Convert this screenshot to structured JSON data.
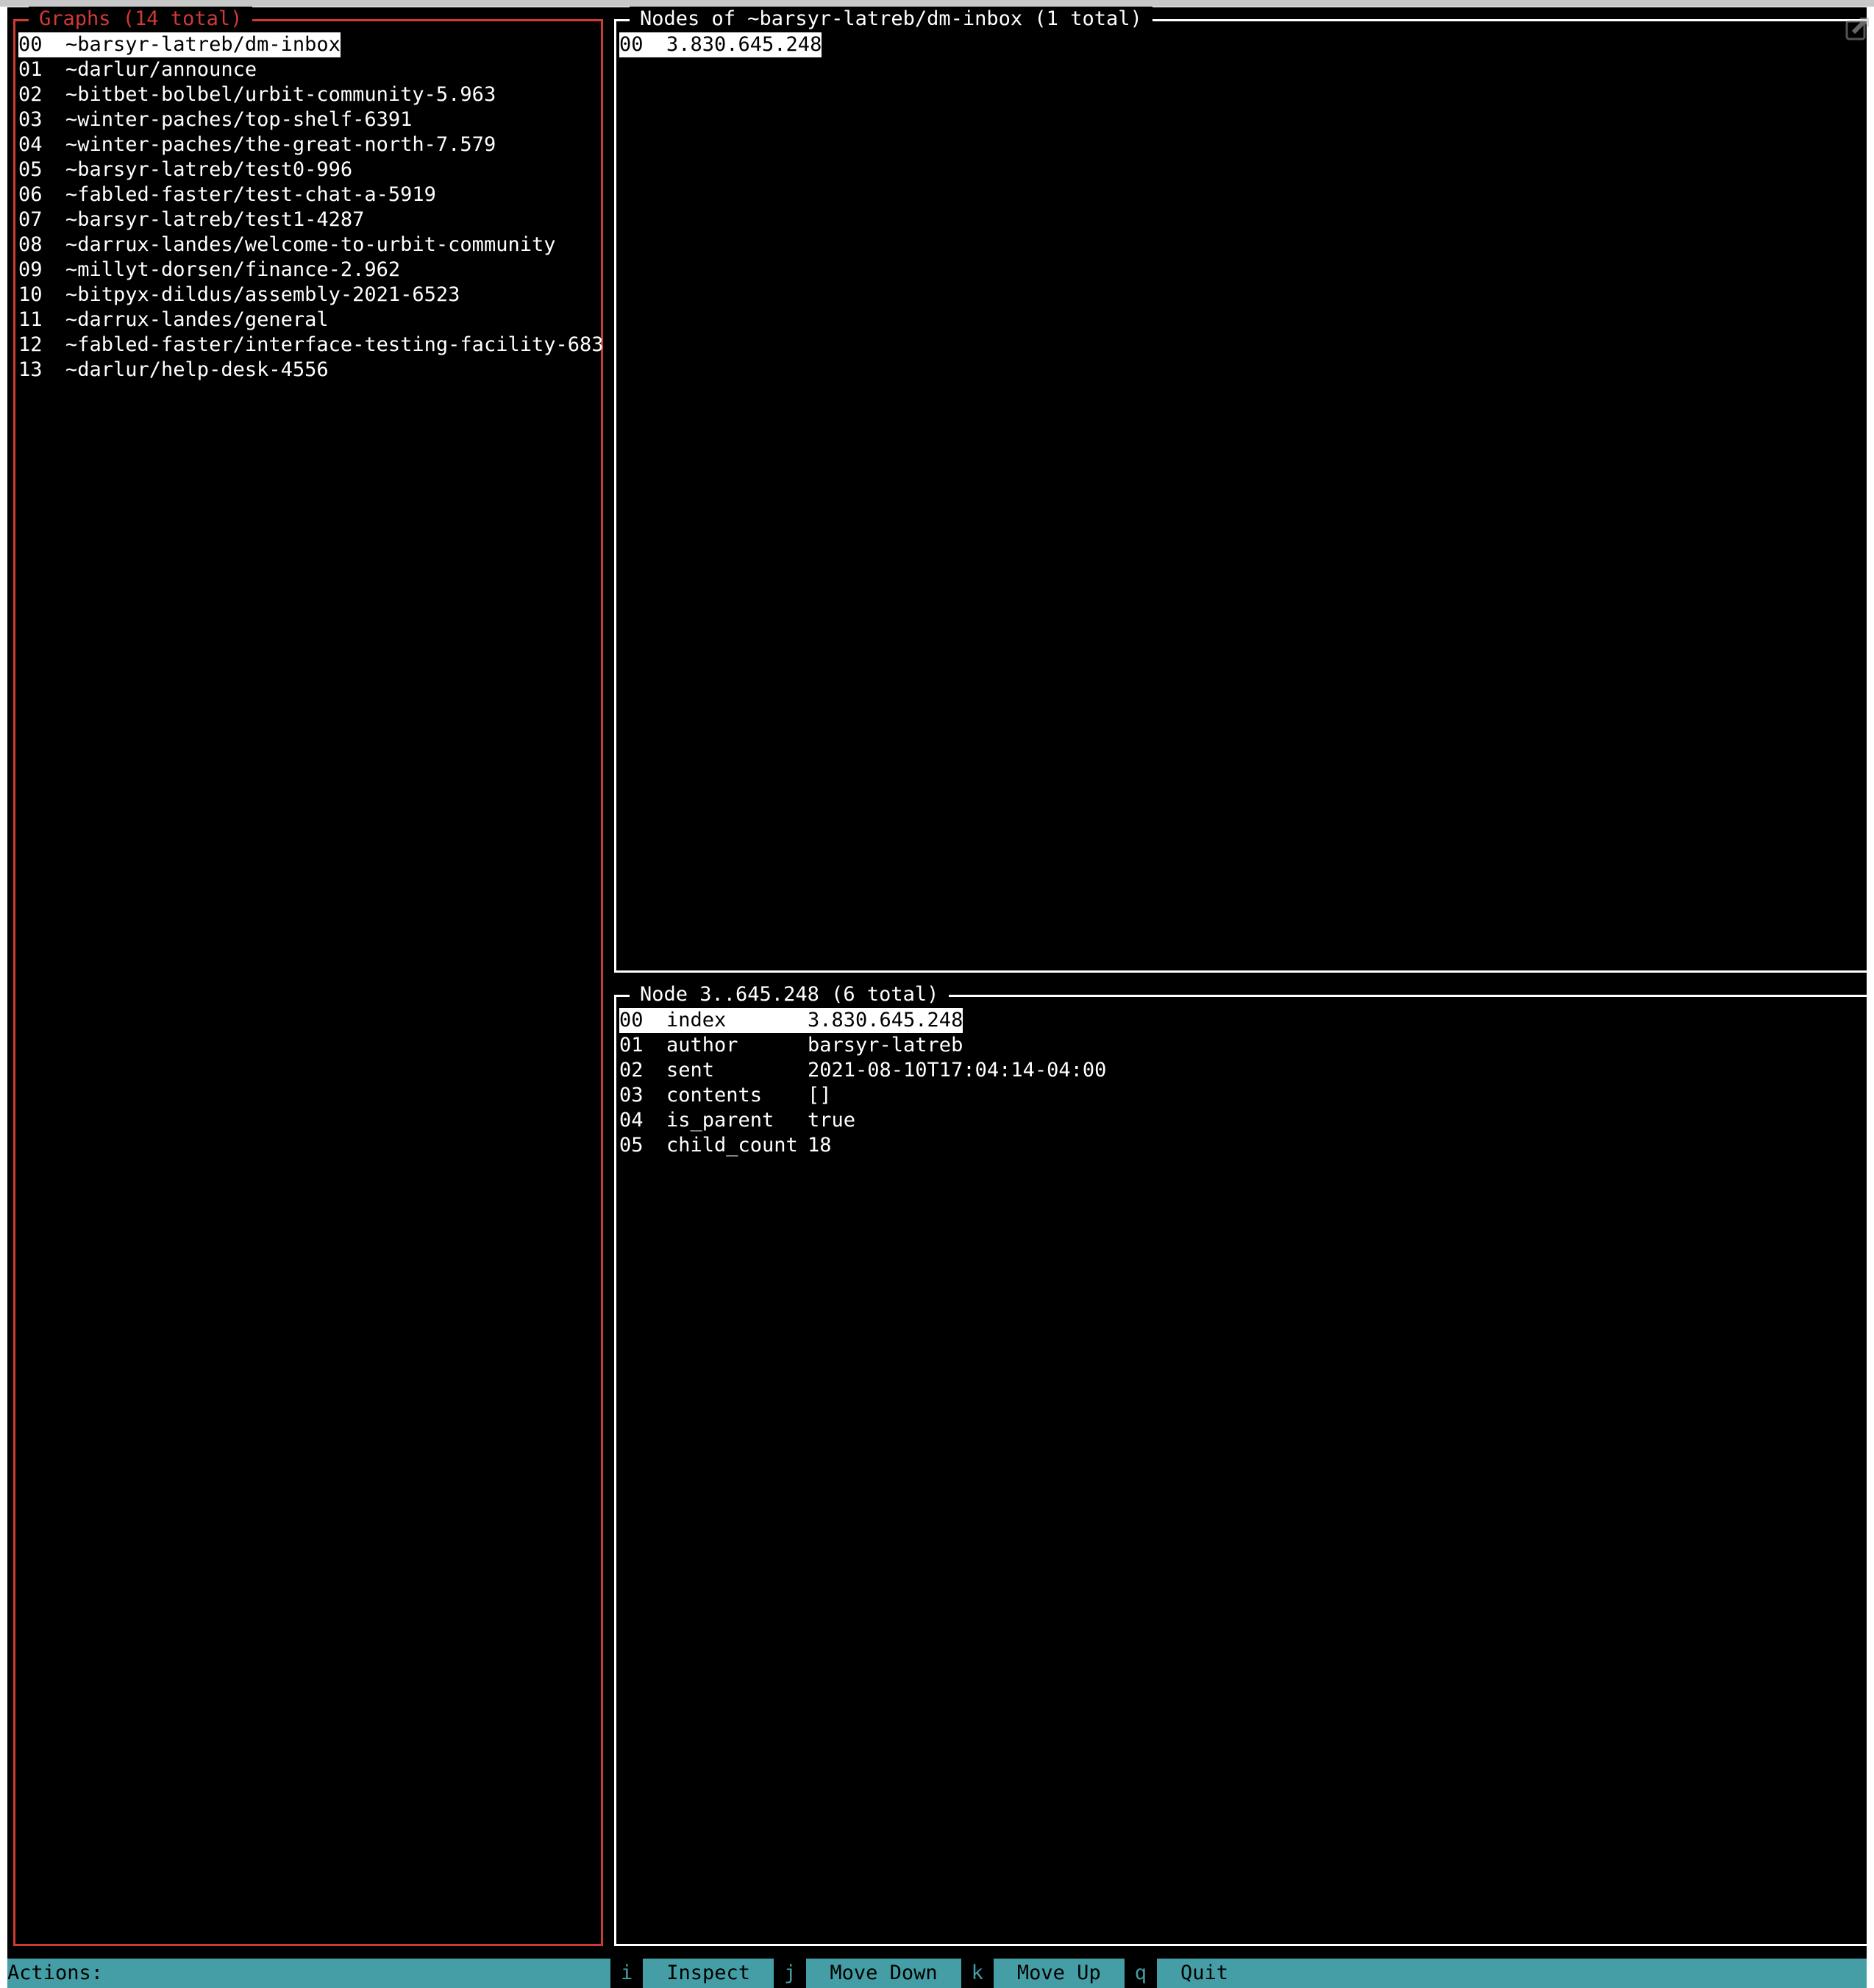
{
  "graphs_panel": {
    "title": "Graphs (14 total)",
    "selected_index": 0,
    "items": [
      {
        "idx": "00",
        "name": "~barsyr-latreb/dm-inbox"
      },
      {
        "idx": "01",
        "name": "~darlur/announce"
      },
      {
        "idx": "02",
        "name": "~bitbet-bolbel/urbit-community-5.963"
      },
      {
        "idx": "03",
        "name": "~winter-paches/top-shelf-6391"
      },
      {
        "idx": "04",
        "name": "~winter-paches/the-great-north-7.579"
      },
      {
        "idx": "05",
        "name": "~barsyr-latreb/test0-996"
      },
      {
        "idx": "06",
        "name": "~fabled-faster/test-chat-a-5919"
      },
      {
        "idx": "07",
        "name": "~barsyr-latreb/test1-4287"
      },
      {
        "idx": "08",
        "name": "~darrux-landes/welcome-to-urbit-community"
      },
      {
        "idx": "09",
        "name": "~millyt-dorsen/finance-2.962"
      },
      {
        "idx": "10",
        "name": "~bitpyx-dildus/assembly-2021-6523"
      },
      {
        "idx": "11",
        "name": "~darrux-landes/general"
      },
      {
        "idx": "12",
        "name": "~fabled-faster/interface-testing-facility-683"
      },
      {
        "idx": "13",
        "name": "~darlur/help-desk-4556"
      }
    ]
  },
  "nodes_panel": {
    "title": "Nodes of ~barsyr-latreb/dm-inbox (1 total)",
    "selected_index": 0,
    "items": [
      {
        "idx": "00",
        "name": "3.830.645.248"
      }
    ]
  },
  "node_panel": {
    "title": "Node 3..645.248 (6 total)",
    "selected_index": 0,
    "fields": [
      {
        "idx": "00",
        "key": "index",
        "value": "3.830.645.248"
      },
      {
        "idx": "01",
        "key": "author",
        "value": "barsyr-latreb"
      },
      {
        "idx": "02",
        "key": "sent",
        "value": "2021-08-10T17:04:14-04:00"
      },
      {
        "idx": "03",
        "key": "contents",
        "value": "[]"
      },
      {
        "idx": "04",
        "key": "is_parent",
        "value": "true"
      },
      {
        "idx": "05",
        "key": "child_count",
        "value": "18"
      }
    ]
  },
  "footer": {
    "label": "Actions:",
    "actions": [
      {
        "key": "i",
        "label": "Inspect"
      },
      {
        "key": "j",
        "label": "Move Down"
      },
      {
        "key": "k",
        "label": "Move Up"
      },
      {
        "key": "q",
        "label": "Quit"
      }
    ]
  },
  "colors": {
    "accent_red": "#d03a35",
    "footer_teal": "#459ea5",
    "background": "#000000",
    "text": "#ffffff"
  },
  "icons": {
    "window_overlay": "open-external-icon"
  }
}
